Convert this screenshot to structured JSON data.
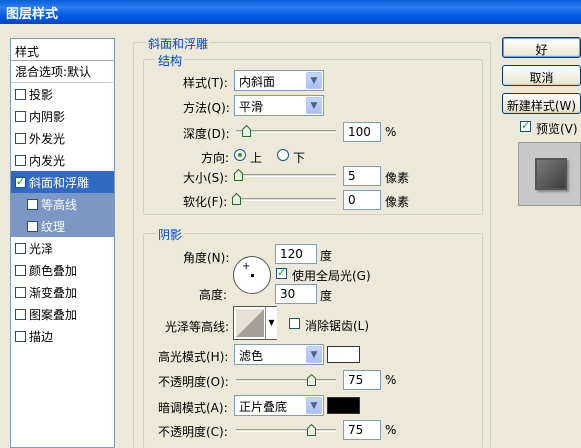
{
  "window": {
    "title": "图层样式"
  },
  "left_list": {
    "header": "样式",
    "blend": "混合选项:默认",
    "items": [
      {
        "label": "投影",
        "checked": false
      },
      {
        "label": "内阴影",
        "checked": false
      },
      {
        "label": "外发光",
        "checked": false
      },
      {
        "label": "内发光",
        "checked": false
      },
      {
        "label": "斜面和浮雕",
        "checked": true
      },
      {
        "label": "等高线",
        "checked": false
      },
      {
        "label": "纹理",
        "checked": false
      },
      {
        "label": "光泽",
        "checked": false
      },
      {
        "label": "颜色叠加",
        "checked": false
      },
      {
        "label": "渐变叠加",
        "checked": false
      },
      {
        "label": "图案叠加",
        "checked": false
      },
      {
        "label": "描边",
        "checked": false
      }
    ]
  },
  "bevel": {
    "title": "斜面和浮雕",
    "structure": {
      "title": "结构",
      "style_label": "样式(T):",
      "style_value": "内斜面",
      "technique_label": "方法(Q):",
      "technique_value": "平滑",
      "depth_label": "深度(D):",
      "depth_value": "100",
      "depth_unit": "%",
      "depth_fraction": 0.1,
      "direction_label": "方向:",
      "direction_up": "上",
      "direction_down": "下",
      "size_label": "大小(S):",
      "size_value": "5",
      "size_unit": "像素",
      "size_fraction": 0.02,
      "soften_label": "软化(F):",
      "soften_value": "0",
      "soften_unit": "像素",
      "soften_fraction": 0.0
    },
    "shading": {
      "title": "阴影",
      "angle_label": "角度(N):",
      "angle_value": "120",
      "angle_unit": "度",
      "global_light_label": "使用全局光(G)",
      "altitude_label": "高度:",
      "altitude_value": "30",
      "altitude_unit": "度",
      "gloss_label": "光泽等高线:",
      "anti_alias_label": "消除锯齿(L)",
      "highlight_mode_label": "高光模式(H):",
      "highlight_mode_value": "滤色",
      "highlight_color": "#ffffff",
      "highlight_opacity_label": "不透明度(O):",
      "highlight_opacity_value": "75",
      "highlight_opacity_unit": "%",
      "highlight_opacity_fraction": 0.75,
      "shadow_mode_label": "暗调模式(A):",
      "shadow_mode_value": "正片叠底",
      "shadow_color": "#000000",
      "shadow_opacity_label": "不透明度(C):",
      "shadow_opacity_value": "75",
      "shadow_opacity_unit": "%",
      "shadow_opacity_fraction": 0.75
    }
  },
  "buttons": {
    "ok": "好",
    "cancel": "取消",
    "new_style": "新建样式(W)",
    "preview_label": "预览(V)"
  },
  "colors": {
    "accent": "#316ac5",
    "title_bar": "#0058e6",
    "legend_text": "#0046d5",
    "check": "#21a121"
  }
}
